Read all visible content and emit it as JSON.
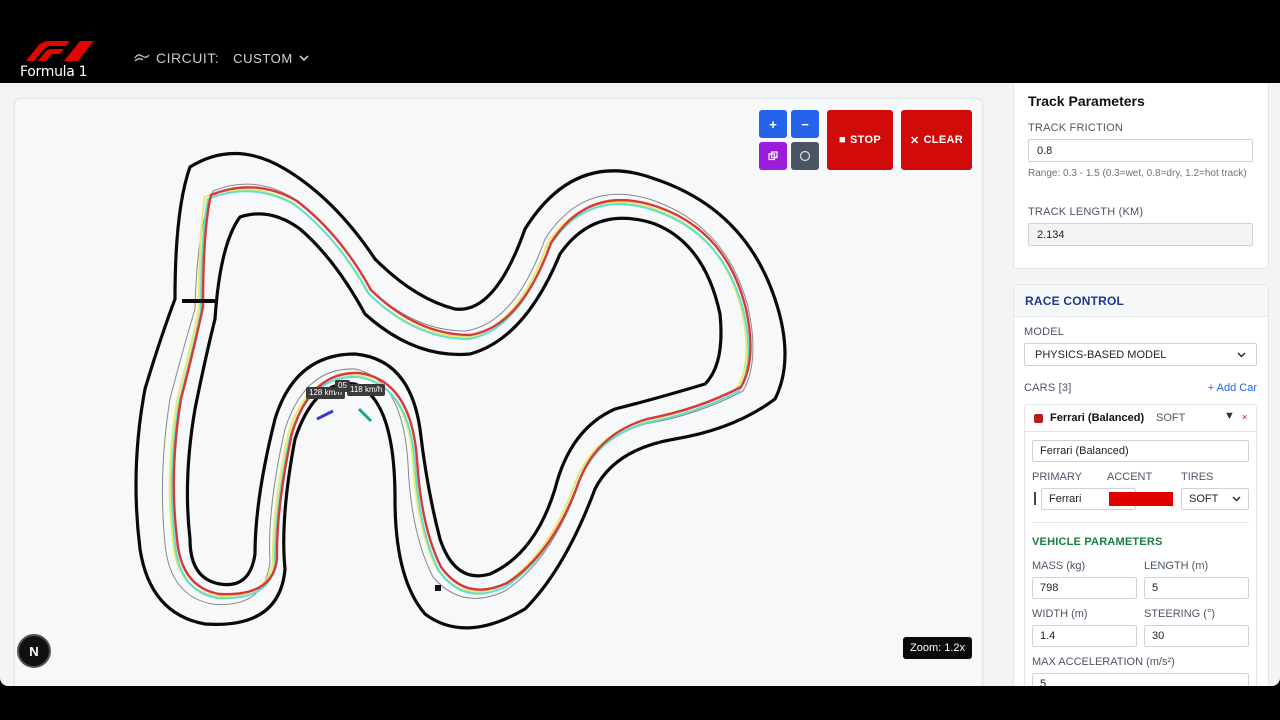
{
  "header": {
    "logo_text": "Formula 1",
    "circuit_label": "CIRCUIT:",
    "circuit_value": "CUSTOM"
  },
  "canvas": {
    "controls": {
      "zoom_in": "+",
      "zoom_out": "−",
      "stop_label": "STOP",
      "clear_label": "CLEAR"
    },
    "speed_tags": [
      "128 km/h",
      "05",
      "118 km/h"
    ],
    "zoom_label": "Zoom: 1.2x",
    "n_badge": "N"
  },
  "track_parameters": {
    "title": "Track Parameters",
    "friction_label": "TRACK FRICTION",
    "friction_value": "0.8",
    "friction_hint": "Range: 0.3 - 1.5 (0.3=wet, 0.8=dry, 1.2=hot track)",
    "length_label": "TRACK LENGTH (KM)",
    "length_value": "2.134"
  },
  "race_control": {
    "title": "RACE CONTROL",
    "model_label": "MODEL",
    "model_value": "PHYSICS-BASED MODEL",
    "cars_label": "CARS [3]",
    "add_car": "+ Add Car",
    "car": {
      "name": "Ferrari (Balanced)",
      "tire": "SOFT",
      "toggle": "▼",
      "remove": "×",
      "name_value": "Ferrari (Balanced)",
      "primary_label": "PRIMARY",
      "accent_label": "ACCENT",
      "tires_label": "TIRES",
      "primary_value": "Ferrari",
      "tires_value": "SOFT",
      "accent_color": "#e00000",
      "vehicle_params_title": "VEHICLE PARAMETERS",
      "mass_label": "MASS (kg)",
      "mass_value": "798",
      "length_label": "LENGTH (m)",
      "length_value": "5",
      "width_label": "WIDTH (m)",
      "width_value": "1.4",
      "steering_label": "STEERING (°)",
      "steering_value": "30",
      "max_accel_label": "MAX ACCELERATION (m/s²)",
      "max_accel_value": "5"
    }
  },
  "colors": {
    "brand_red": "#d10a0a",
    "button_blue": "#2563eb",
    "button_purple": "#9b1ddb",
    "racing_line_red": "#d63a3a",
    "racing_line_yellow": "#e8e86a",
    "racing_line_cyan": "#5ee0d0"
  }
}
